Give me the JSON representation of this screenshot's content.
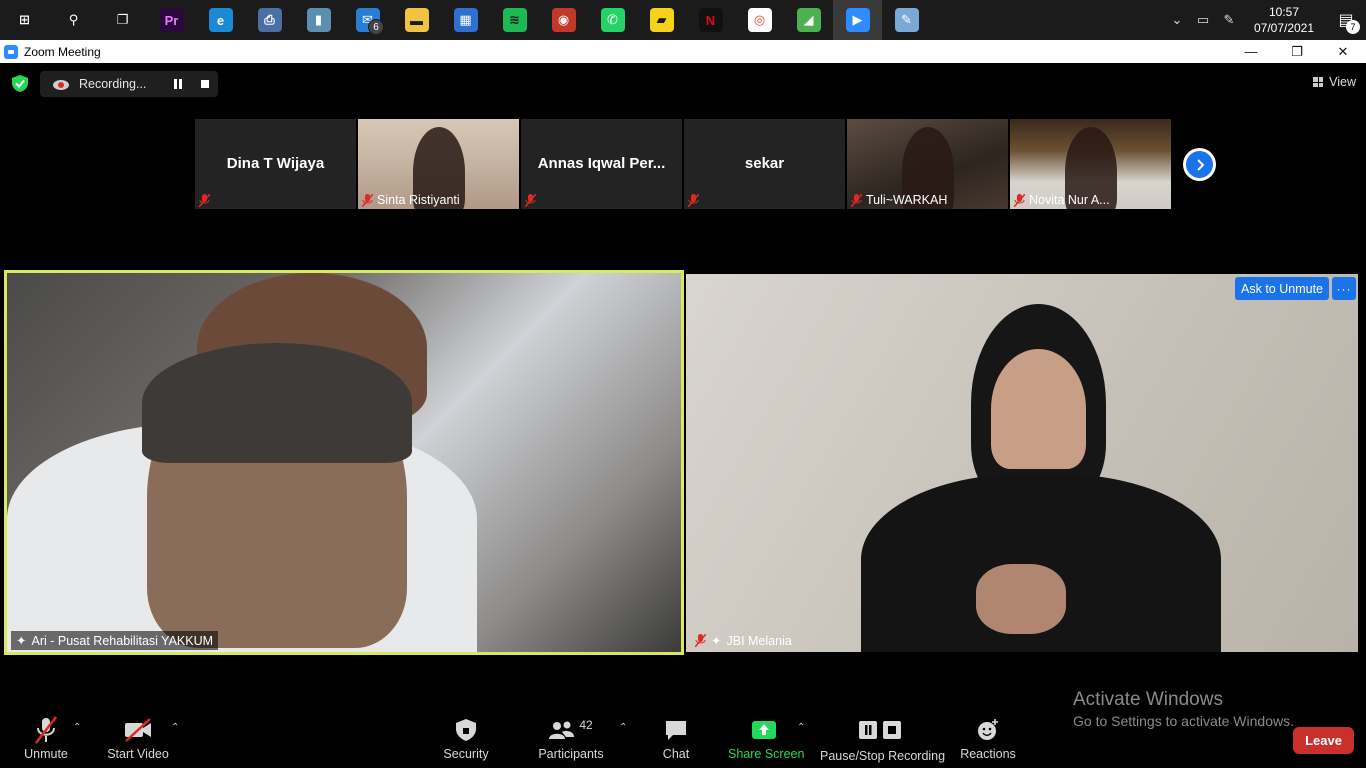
{
  "taskbar": {
    "apps": [
      {
        "name": "windows-start",
        "glyph": "⊞",
        "color": "#ffffff",
        "bg": "transparent"
      },
      {
        "name": "search",
        "glyph": "⚲",
        "color": "#ffffff",
        "bg": "transparent"
      },
      {
        "name": "task-view",
        "glyph": "❐",
        "color": "#ffffff",
        "bg": "transparent"
      },
      {
        "name": "premiere-pro",
        "glyph": "Pr",
        "color": "#e77cff",
        "bg": "#2a0a3a"
      },
      {
        "name": "edge",
        "glyph": "e",
        "color": "#ffffff",
        "bg": "#1b8ad6"
      },
      {
        "name": "network-app",
        "glyph": "⎙",
        "color": "#ffffff",
        "bg": "#4a6fa5"
      },
      {
        "name": "notes-app",
        "glyph": "▮",
        "color": "#ffffff",
        "bg": "#5a8fb0"
      },
      {
        "name": "mail",
        "glyph": "✉",
        "color": "#ffffff",
        "bg": "#2b7cd3",
        "badge": "6"
      },
      {
        "name": "file-explorer",
        "glyph": "▬",
        "color": "#1b1b1b",
        "bg": "#f2c341"
      },
      {
        "name": "store",
        "glyph": "▦",
        "color": "#ffffff",
        "bg": "#2f6fd0"
      },
      {
        "name": "spotify",
        "glyph": "≋",
        "color": "#1b1b1b",
        "bg": "#1db954"
      },
      {
        "name": "app-red",
        "glyph": "◉",
        "color": "#ffffff",
        "bg": "#c0392b"
      },
      {
        "name": "whatsapp",
        "glyph": "✆",
        "color": "#ffffff",
        "bg": "#25d366"
      },
      {
        "name": "sticky-notes",
        "glyph": "▰",
        "color": "#1b1b1b",
        "bg": "#f7d21a"
      },
      {
        "name": "netflix",
        "glyph": "N",
        "color": "#e50914",
        "bg": "#111111"
      },
      {
        "name": "chrome",
        "glyph": "◎",
        "color": "#ea4335",
        "bg": "#ffffff"
      },
      {
        "name": "app-green",
        "glyph": "◢",
        "color": "#ffffff",
        "bg": "#4caf50"
      },
      {
        "name": "zoom",
        "glyph": "▶",
        "color": "#ffffff",
        "bg": "#2d8cff",
        "active": true
      },
      {
        "name": "paint",
        "glyph": "✎",
        "color": "#ffffff",
        "bg": "#7aa9d6"
      }
    ],
    "time": "10:57",
    "date": "07/07/2021",
    "notifications": "7"
  },
  "window": {
    "title": "Zoom Meeting"
  },
  "meeting": {
    "recording_label": "Recording...",
    "view_label": "View",
    "thumbnails": [
      {
        "name": "Dina T Wijaya",
        "video": false,
        "style": ""
      },
      {
        "name": "Sinta Ristiyanti",
        "video": true,
        "style": "vid-a"
      },
      {
        "name": "Annas Iqwal Per...",
        "video": false,
        "style": ""
      },
      {
        "name": "sekar",
        "video": false,
        "style": ""
      },
      {
        "name": "Tuli~WARKAH",
        "video": true,
        "style": "vid-b"
      },
      {
        "name": "Novita Nur A...",
        "video": true,
        "style": "vid-c"
      }
    ],
    "main_left_name": "Ari - Pusat Rehabilitasi YAKKUM",
    "main_right_name": "JBI Melania",
    "ask_unmute_label": "Ask to Unmute",
    "more_label": "···",
    "active_speaker_color": "#d9e860"
  },
  "watermark": {
    "line1": "Activate Windows",
    "line2": "Go to Settings to activate Windows."
  },
  "toolbar": {
    "unmute_label": "Unmute",
    "start_video_label": "Start Video",
    "security_label": "Security",
    "participants_label": "Participants",
    "participants_count": "42",
    "chat_label": "Chat",
    "share_screen_label": "Share Screen",
    "pause_stop_label": "Pause/Stop Recording",
    "reactions_label": "Reactions",
    "leave_label": "Leave",
    "caret": "⌃"
  }
}
